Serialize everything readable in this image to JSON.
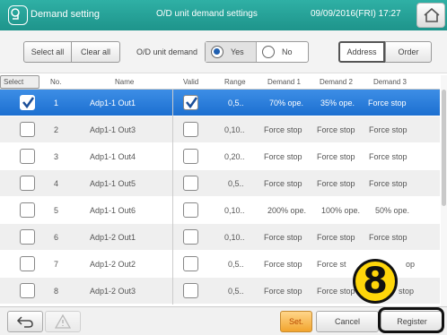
{
  "header": {
    "title": "Demand setting",
    "center_title": "O/D unit demand settings",
    "datetime": "09/09/2016(FRI) 17:27"
  },
  "toolbar": {
    "select_all": "Select all",
    "clear_all": "Clear all",
    "od_label": "O/D unit demand",
    "radio_yes": "Yes",
    "radio_no": "No",
    "selected_radio": "Yes",
    "address": "Address",
    "order": "Order"
  },
  "table": {
    "columns": [
      "Select",
      "No.",
      "Name",
      "Valid",
      "Range",
      "Demand 1",
      "Demand 2",
      "Demand 3"
    ],
    "rows": [
      {
        "no": "1",
        "name": "Adp1-1 Out1",
        "valid": true,
        "range": "0,5..",
        "d1": "70% ope.",
        "d2": "35% ope.",
        "d3": "Force stop",
        "selected": true
      },
      {
        "no": "2",
        "name": "Adp1-1 Out3",
        "valid": false,
        "range": "0,10..",
        "d1": "Force stop",
        "d2": "Force stop",
        "d3": "Force stop",
        "selected": false
      },
      {
        "no": "3",
        "name": "Adp1-1 Out4",
        "valid": false,
        "range": "0,20..",
        "d1": "Force stop",
        "d2": "Force stop",
        "d3": "Force stop",
        "selected": false
      },
      {
        "no": "4",
        "name": "Adp1-1 Out5",
        "valid": false,
        "range": "0,5..",
        "d1": "Force stop",
        "d2": "Force stop",
        "d3": "Force stop",
        "selected": false
      },
      {
        "no": "5",
        "name": "Adp1-1 Out6",
        "valid": false,
        "range": "0,10..",
        "d1": "200% ope.",
        "d2": "100% ope.",
        "d3": "50% ope.",
        "selected": false
      },
      {
        "no": "6",
        "name": "Adp1-2 Out1",
        "valid": false,
        "range": "0,10..",
        "d1": "Force stop",
        "d2": "Force stop",
        "d3": "Force stop",
        "selected": false
      },
      {
        "no": "7",
        "name": "Adp1-2 Out2",
        "valid": false,
        "range": "0,5..",
        "d1": "Force stop",
        "d2": "Force st",
        "d3": "op",
        "selected": false
      },
      {
        "no": "8",
        "name": "Adp1-2 Out3",
        "valid": false,
        "range": "0,5..",
        "d1": "Force stop",
        "d2": "Force stop",
        "d3": "stop",
        "selected": false
      }
    ]
  },
  "footer": {
    "set": "Set.",
    "cancel": "Cancel",
    "register": "Register"
  },
  "annotation": {
    "step_number": "8"
  },
  "colors": {
    "header": "#22a096",
    "selected_row": "#2a7ddb",
    "set_button": "#f5b040",
    "callout": "#ffd60a"
  },
  "icons": {
    "app": "demand-setting-icon",
    "home": "home-icon",
    "back": "back-arrow-icon",
    "warning": "warning-icon",
    "check": "checkmark-icon"
  }
}
